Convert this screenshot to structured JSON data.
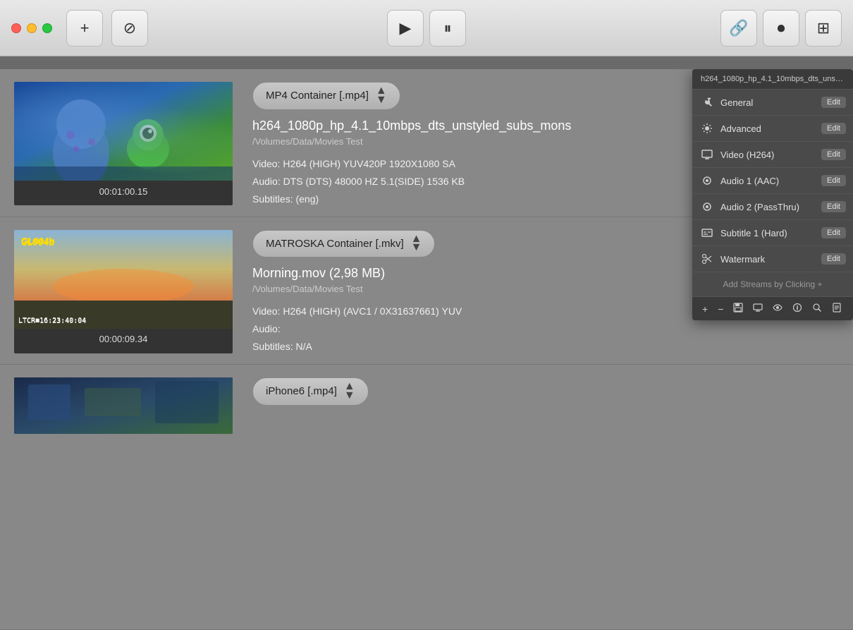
{
  "titlebar": {
    "btn_add": "+",
    "btn_cancel": "⊘",
    "btn_play": "▶",
    "btn_pause": "⏸",
    "btn_link": "🔗",
    "btn_record": "⏺",
    "btn_gallery": "⊞"
  },
  "dropdown": {
    "header_title": "h264_1080p_hp_4.1_10mbps_dts_unsty...",
    "items": [
      {
        "icon": "wrench",
        "label": "General",
        "edit": "Edit"
      },
      {
        "icon": "gear",
        "label": "Advanced",
        "edit": "Edit"
      },
      {
        "icon": "monitor",
        "label": "Video (H264)",
        "edit": "Edit"
      },
      {
        "icon": "audio",
        "label": "Audio 1 (AAC)",
        "edit": "Edit"
      },
      {
        "icon": "audio2",
        "label": "Audio 2 (PassThru)",
        "edit": "Edit"
      },
      {
        "icon": "subtitle",
        "label": "Subtitle 1 (Hard)",
        "edit": "Edit"
      },
      {
        "icon": "watermark",
        "label": "Watermark",
        "edit": "Edit"
      }
    ],
    "footer": "Add Streams by Clicking +",
    "toolbar_buttons": [
      "+",
      "−",
      "💾",
      "⊡",
      "◉",
      "ⓘ",
      "🔍",
      "📄"
    ]
  },
  "rows": [
    {
      "container": "MP4 Container [.mp4]",
      "title": "h264_1080p_hp_4.1_10mbps_dts_unstyled_subs_mons",
      "path": "/Volumes/Data/Movies Test",
      "video": "Video: H264 (HIGH)   YUV420P   1920X1080   SA",
      "audio": "Audio: DTS (DTS)  48000 HZ  5.1(SIDE)  1536 KB",
      "subtitles": "Subtitles: (eng)",
      "timestamp": "00:01:00.15",
      "thumb_type": "monsters"
    },
    {
      "container": "MATROSKA Container [.mkv]",
      "title": "Morning.mov  (2,98 MB)",
      "path": "/Volumes/Data/Movies Test",
      "video": "Video: H264 (HIGH) (AVC1 / 0X31637661)   YUV",
      "audio": "Audio:",
      "subtitles": "Subtitles: N/A",
      "timestamp": "00:00:09.34",
      "thumb_type": "aerial"
    },
    {
      "container": "iPhone6 [.mp4]",
      "title": "",
      "path": "",
      "video": "",
      "audio": "",
      "subtitles": "",
      "timestamp": "",
      "thumb_type": "third"
    }
  ]
}
